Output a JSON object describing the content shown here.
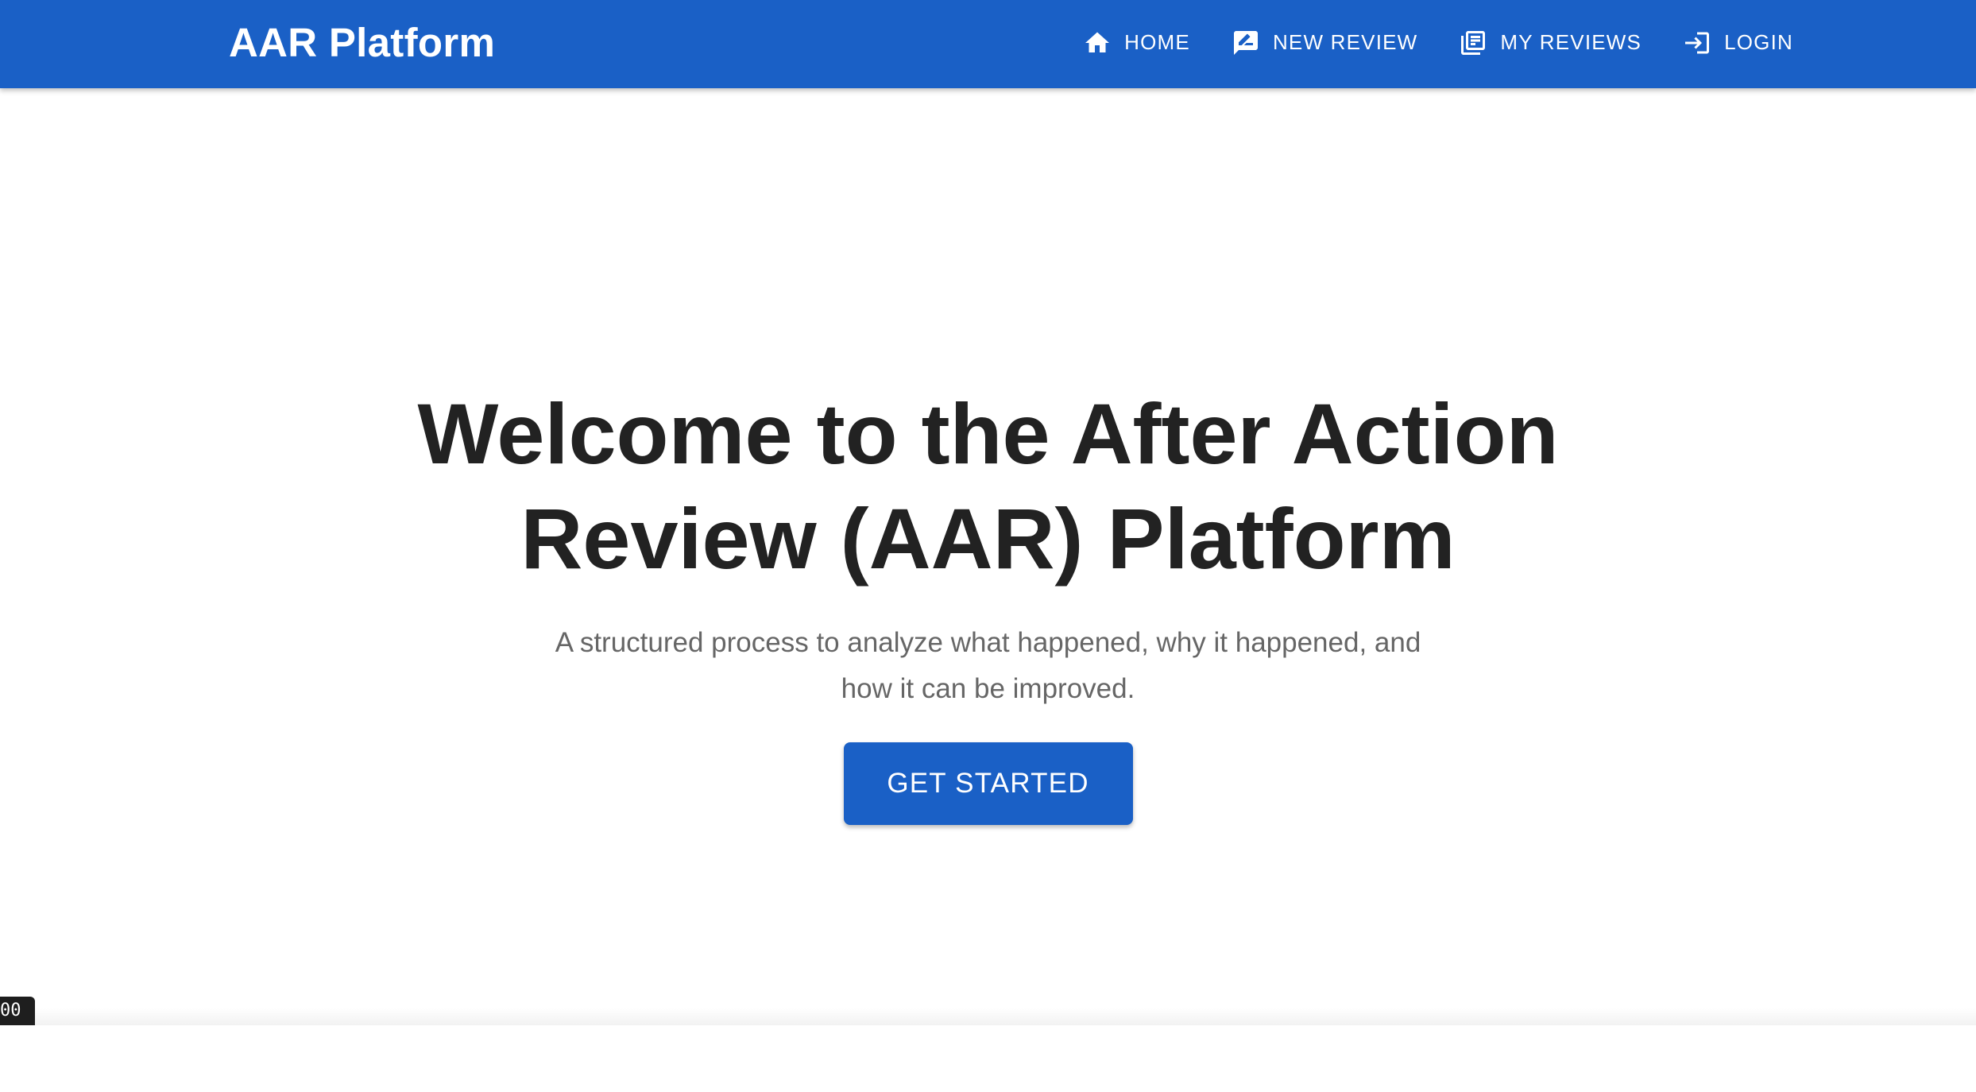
{
  "header": {
    "brand": "AAR Platform",
    "nav": [
      {
        "label": "HOME",
        "icon": "home-icon"
      },
      {
        "label": "NEW REVIEW",
        "icon": "rate-review-icon"
      },
      {
        "label": "MY REVIEWS",
        "icon": "library-books-icon"
      },
      {
        "label": "LOGIN",
        "icon": "login-icon"
      }
    ]
  },
  "hero": {
    "title": "Welcome to the After Action Review (AAR) Platform",
    "subtitle": "A structured process to analyze what happened, why it happened, and how it can be improved.",
    "cta_label": "GET STARTED"
  },
  "debug_badge": "00",
  "colors": {
    "primary": "#1a60c6",
    "title_text": "#222222",
    "subtitle_text": "#666666"
  }
}
